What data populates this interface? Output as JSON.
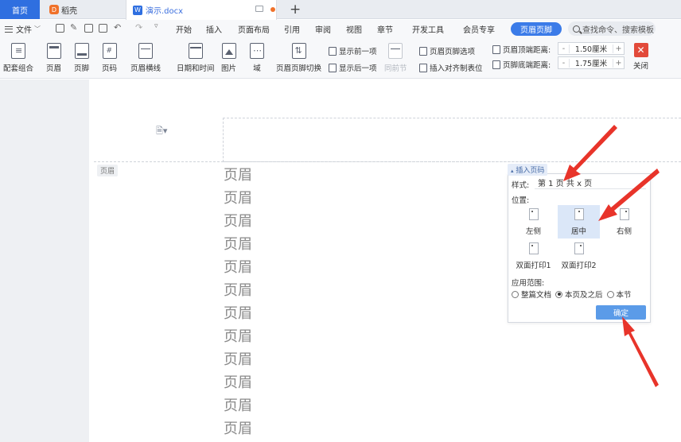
{
  "tabs": {
    "home": "首页",
    "daoke": "稻壳",
    "daoke_logo": "D",
    "doc": "演示.docx",
    "doc_logo": "W"
  },
  "menu": {
    "file": "文件",
    "tabs": [
      "开始",
      "插入",
      "页面布局",
      "引用",
      "审阅",
      "视图",
      "章节",
      "开发工具",
      "会员专享"
    ],
    "active_tab": "页眉页脚",
    "search_placeholder": "查找命令、搜索模板"
  },
  "ribbon": {
    "buttons": {
      "combo": "配套组合",
      "header": "页眉",
      "footer": "页脚",
      "page_number": "页码",
      "header_line": "页眉横线",
      "datetime": "日期和时间",
      "picture": "图片",
      "field": "域",
      "switch": "页眉页脚切换"
    },
    "small": {
      "show_prev": "显示前一项",
      "show_next": "显示后一项",
      "same_as_prev": "同前节",
      "hf_options": "页眉页脚选项",
      "insert_align_tab": "插入对齐制表位"
    },
    "spinners": {
      "header_top_label": "页眉顶端距离:",
      "header_top_value": "1.50厘米",
      "footer_bottom_label": "页脚底端距离:",
      "footer_bottom_value": "1.75厘米"
    },
    "close": "关闭"
  },
  "document": {
    "header_tag": "页眉",
    "lines": [
      "页眉",
      "页眉",
      "页眉",
      "页眉",
      "页眉",
      "页眉",
      "页眉",
      "页眉",
      "页眉",
      "页眉",
      "页眉",
      "页眉"
    ]
  },
  "dialog": {
    "title": "插入页码",
    "style_label": "样式:",
    "style_value": "第 1 页 共 x 页",
    "position_label": "位置:",
    "positions": [
      "左侧",
      "居中",
      "右侧",
      "双面打印1",
      "双面打印2"
    ],
    "selected_position": "居中",
    "scope_label": "应用范围:",
    "scopes": [
      "整篇文档",
      "本页及之后",
      "本节"
    ],
    "selected_scope": "本页及之后",
    "ok": "确定"
  },
  "colors": {
    "accent": "#3b7be8",
    "arrow": "#e8342a",
    "close": "#e24a3a"
  }
}
